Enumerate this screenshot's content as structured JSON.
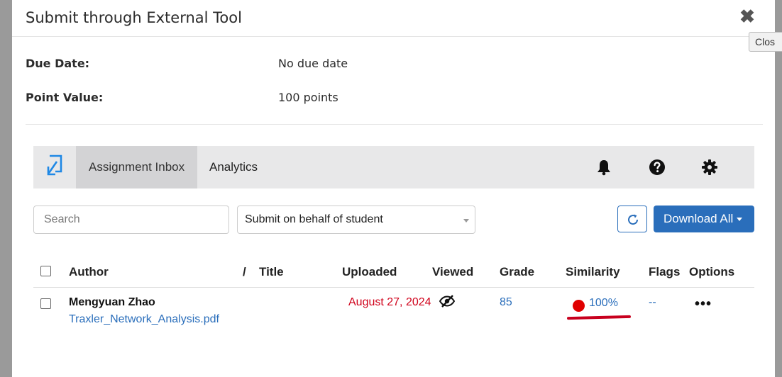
{
  "modal": {
    "title": "Submit through External Tool",
    "close_tooltip": "Clos"
  },
  "details": {
    "due_date_label": "Due Date:",
    "due_date_value": "No due date",
    "point_value_label": "Point Value:",
    "point_value_value": "100 points"
  },
  "tool_nav": {
    "tabs": [
      {
        "label": "Assignment Inbox",
        "active": true
      },
      {
        "label": "Analytics",
        "active": false
      }
    ],
    "icons": [
      "bell-icon",
      "help-icon",
      "gear-icon"
    ]
  },
  "toolbar": {
    "search_placeholder": "Search",
    "behalf_select_value": "Submit on behalf of student",
    "download_label": "Download All"
  },
  "table": {
    "headers": {
      "author": "Author",
      "slash": "/",
      "title": "Title",
      "uploaded": "Uploaded",
      "viewed": "Viewed",
      "grade": "Grade",
      "similarity": "Similarity",
      "flags": "Flags",
      "options": "Options"
    },
    "rows": [
      {
        "author": "Mengyuan Zhao",
        "file": "Traxler_Network_Analysis.pdf",
        "uploaded": "August 27, 2024",
        "grade": "85",
        "similarity": "100%",
        "flags": "--",
        "options": "•••"
      }
    ]
  },
  "colors": {
    "primary": "#2a6ebb",
    "late_red": "#d0021b",
    "similarity_dot": "#e00000",
    "nav_bg": "#e8e8e9"
  }
}
